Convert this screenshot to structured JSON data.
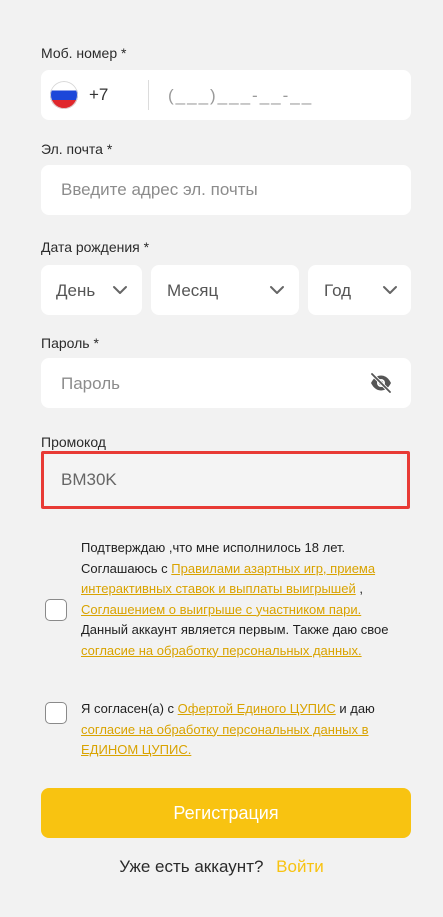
{
  "phone": {
    "label": "Моб. номер *",
    "code": "+7",
    "mask": "(___)___-__-__"
  },
  "email": {
    "label": "Эл. почта *",
    "placeholder": "Введите адрес эл. почты"
  },
  "birth": {
    "label": "Дата рождения *",
    "day": "День",
    "month": "Месяц",
    "year": "Год"
  },
  "password": {
    "label": "Пароль *",
    "placeholder": "Пароль"
  },
  "promo": {
    "label": "Промокод",
    "value": "BM30K"
  },
  "consent1": {
    "t1": "Подтверждаю ,что мне исполнилось 18 лет. Соглашаюсь с ",
    "l1": "Правилами азартных игр, приема интерактивных ставок и выплаты выигрышей",
    "t2": " , ",
    "l2": "Соглашением о выигрыше с участником пари.",
    "t3": " Данный аккаунт является первым. Также даю свое ",
    "l3": "согласие на обработку персональных данных."
  },
  "consent2": {
    "t1": "Я согласен(а) с ",
    "l1": "Офертой Единого ЦУПИС",
    "t2": " и даю ",
    "l2": "согласие на обработку персональных данных в ЕДИНОМ ЦУПИС."
  },
  "register_label": "Регистрация",
  "login": {
    "question": "Уже есть аккаунт?",
    "link": "Войти"
  },
  "colors": {
    "accent": "#f8c311",
    "link": "#d9a300",
    "highlight": "#e83a35"
  }
}
